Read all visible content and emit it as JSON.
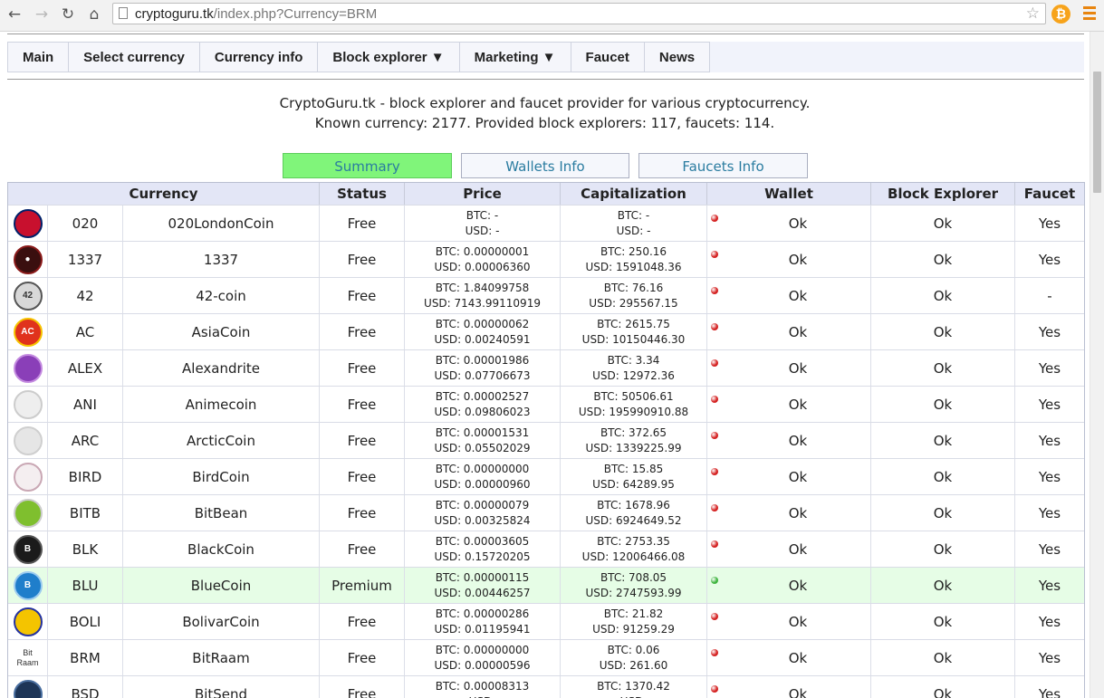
{
  "browser": {
    "url_host": "cryptoguru.tk",
    "url_path": "/index.php?Currency=BRM"
  },
  "nav": [
    {
      "label": "Main"
    },
    {
      "label": "Select currency"
    },
    {
      "label": "Currency info"
    },
    {
      "label": "Block explorer ▼"
    },
    {
      "label": "Marketing ▼"
    },
    {
      "label": "Faucet"
    },
    {
      "label": "News"
    }
  ],
  "intro": {
    "line1": "CryptoGuru.tk - block explorer and faucet provider for various cryptocurrency.",
    "line2": "Known currency: 2177. Provided block explorers: 117, faucets: 114."
  },
  "tabs": {
    "summary": "Summary",
    "wallets": "Wallets Info",
    "faucets": "Faucets Info"
  },
  "table": {
    "headers": {
      "currency": "Currency",
      "status": "Status",
      "price": "Price",
      "cap": "Capitalization",
      "wallet": "Wallet",
      "be": "Block Explorer",
      "faucet": "Faucet"
    },
    "rows": [
      {
        "code": "020",
        "name": "020LondonCoin",
        "status": "Free",
        "price_btc": "BTC: -",
        "price_usd": "USD: -",
        "cap_btc": "BTC: -",
        "cap_usd": "USD: -",
        "wallet": "Ok",
        "be": "Ok",
        "faucet": "Yes",
        "dot": "#d42020",
        "icon_bg": "#c8102e",
        "icon_border": "#012169",
        "icon_text": ""
      },
      {
        "code": "1337",
        "name": "1337",
        "status": "Free",
        "price_btc": "BTC: 0.00000001",
        "price_usd": "USD: 0.00006360",
        "cap_btc": "BTC: 250.16",
        "cap_usd": "USD: 1591048.36",
        "wallet": "Ok",
        "be": "Ok",
        "faucet": "Yes",
        "dot": "#d42020",
        "icon_bg": "#3a0f0f",
        "icon_border": "#8a1a1a",
        "icon_text": "●"
      },
      {
        "code": "42",
        "name": "42-coin",
        "status": "Free",
        "price_btc": "BTC: 1.84099758",
        "price_usd": "USD: 7143.99110919",
        "cap_btc": "BTC: 76.16",
        "cap_usd": "USD: 295567.15",
        "wallet": "Ok",
        "be": "Ok",
        "faucet": "-",
        "dot": "#d42020",
        "icon_bg": "#d8d8d8",
        "icon_border": "#555555",
        "icon_text": "42"
      },
      {
        "code": "AC",
        "name": "AsiaCoin",
        "status": "Free",
        "price_btc": "BTC: 0.00000062",
        "price_usd": "USD: 0.00240591",
        "cap_btc": "BTC: 2615.75",
        "cap_usd": "USD: 10150446.30",
        "wallet": "Ok",
        "be": "Ok",
        "faucet": "Yes",
        "dot": "#d42020",
        "icon_bg": "#e0321c",
        "icon_border": "#f5c400",
        "icon_text": "AC"
      },
      {
        "code": "ALEX",
        "name": "Alexandrite",
        "status": "Free",
        "price_btc": "BTC: 0.00001986",
        "price_usd": "USD: 0.07706673",
        "cap_btc": "BTC: 3.34",
        "cap_usd": "USD: 12972.36",
        "wallet": "Ok",
        "be": "Ok",
        "faucet": "Yes",
        "dot": "#d42020",
        "icon_bg": "#8a3fb8",
        "icon_border": "#c48be0",
        "icon_text": ""
      },
      {
        "code": "ANI",
        "name": "Animecoin",
        "status": "Free",
        "price_btc": "BTC: 0.00002527",
        "price_usd": "USD: 0.09806023",
        "cap_btc": "BTC: 50506.61",
        "cap_usd": "USD: 195990910.88",
        "wallet": "Ok",
        "be": "Ok",
        "faucet": "Yes",
        "dot": "#d42020",
        "icon_bg": "#eeeeee",
        "icon_border": "#cccccc",
        "icon_text": ""
      },
      {
        "code": "ARC",
        "name": "ArcticCoin",
        "status": "Free",
        "price_btc": "BTC: 0.00001531",
        "price_usd": "USD: 0.05502029",
        "cap_btc": "BTC: 372.65",
        "cap_usd": "USD: 1339225.99",
        "wallet": "Ok",
        "be": "Ok",
        "faucet": "Yes",
        "dot": "#d42020",
        "icon_bg": "#e6e6e6",
        "icon_border": "#cfcfcf",
        "icon_text": ""
      },
      {
        "code": "BIRD",
        "name": "BirdCoin",
        "status": "Free",
        "price_btc": "BTC: 0.00000000",
        "price_usd": "USD: 0.00000960",
        "cap_btc": "BTC: 15.85",
        "cap_usd": "USD: 64289.95",
        "wallet": "Ok",
        "be": "Ok",
        "faucet": "Yes",
        "dot": "#d42020",
        "icon_bg": "#f4eef0",
        "icon_border": "#c9a7b4",
        "icon_text": ""
      },
      {
        "code": "BITB",
        "name": "BitBean",
        "status": "Free",
        "price_btc": "BTC: 0.00000079",
        "price_usd": "USD: 0.00325824",
        "cap_btc": "BTC: 1678.96",
        "cap_usd": "USD: 6924649.52",
        "wallet": "Ok",
        "be": "Ok",
        "faucet": "Yes",
        "dot": "#d42020",
        "icon_bg": "#7fbf2e",
        "icon_border": "#cccccc",
        "icon_text": ""
      },
      {
        "code": "BLK",
        "name": "BlackCoin",
        "status": "Free",
        "price_btc": "BTC: 0.00003605",
        "price_usd": "USD: 0.15720205",
        "cap_btc": "BTC: 2753.35",
        "cap_usd": "USD: 12006466.08",
        "wallet": "Ok",
        "be": "Ok",
        "faucet": "Yes",
        "dot": "#d42020",
        "icon_bg": "#1b1b1b",
        "icon_border": "#555555",
        "icon_text": "B"
      },
      {
        "code": "BLU",
        "name": "BlueCoin",
        "status": "Premium",
        "price_btc": "BTC: 0.00000115",
        "price_usd": "USD: 0.00446257",
        "cap_btc": "BTC: 708.05",
        "cap_usd": "USD: 2747593.99",
        "wallet": "Ok",
        "be": "Ok",
        "faucet": "Yes",
        "dot": "#3cb43c",
        "icon_bg": "#1f7ecb",
        "icon_border": "#9ccbef",
        "icon_text": "B"
      },
      {
        "code": "BOLI",
        "name": "BolivarCoin",
        "status": "Free",
        "price_btc": "BTC: 0.00000286",
        "price_usd": "USD: 0.01195941",
        "cap_btc": "BTC: 21.82",
        "cap_usd": "USD: 91259.29",
        "wallet": "Ok",
        "be": "Ok",
        "faucet": "Yes",
        "dot": "#d42020",
        "icon_bg": "#f4c400",
        "icon_border": "#2432a0",
        "icon_text": ""
      },
      {
        "code": "BRM",
        "name": "BitRaam",
        "status": "Free",
        "price_btc": "BTC: 0.00000000",
        "price_usd": "USD: 0.00000596",
        "cap_btc": "BTC: 0.06",
        "cap_usd": "USD: 261.60",
        "wallet": "Ok",
        "be": "Ok",
        "faucet": "Yes",
        "dot": "#d42020",
        "icon_bg": "#ffffff",
        "icon_border": "#ffffff",
        "icon_text": "Bit Raam"
      },
      {
        "code": "BSD",
        "name": "BitSend",
        "status": "Free",
        "price_btc": "BTC: 0.00008313",
        "price_usd": "USD:",
        "cap_btc": "BTC: 1370.42",
        "cap_usd": "USD:",
        "wallet": "Ok",
        "be": "Ok",
        "faucet": "Yes",
        "dot": "#d42020",
        "icon_bg": "#1d3557",
        "icon_border": "#4a6fa0",
        "icon_text": ""
      }
    ]
  }
}
